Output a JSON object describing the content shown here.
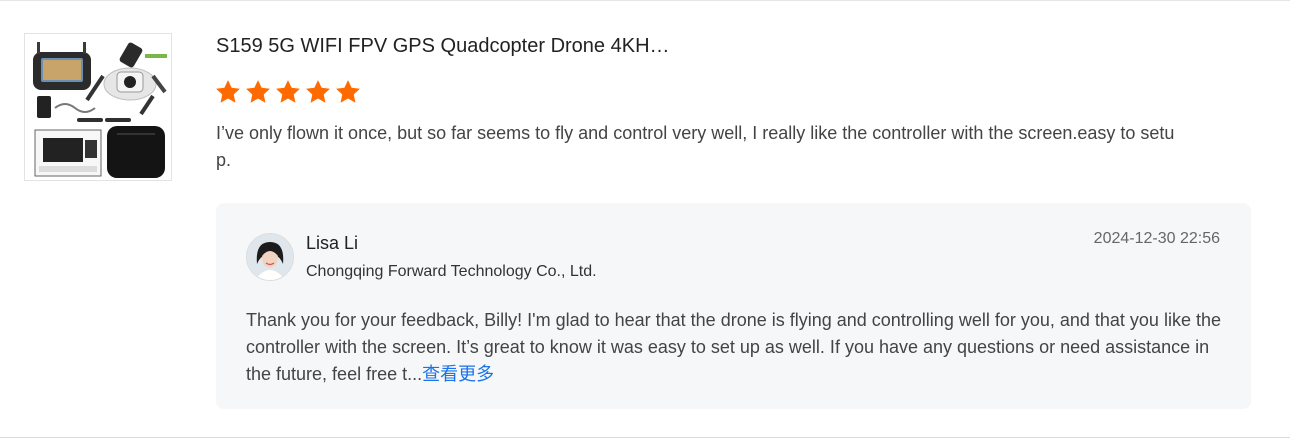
{
  "product": {
    "title": "S159 5G WIFI FPV GPS Quadcopter Drone 4KH…",
    "rating": 5,
    "rating_max": 5,
    "star_color": "#ff6a00",
    "image_icon": "drone-product-thumbnail"
  },
  "review": {
    "text": "I’ve only flown it once, but so far seems to fly and control very well, I really like the controller with the screen.easy to setup."
  },
  "reply": {
    "name": "Lisa Li",
    "company": "Chongqing Forward Technology Co., Ltd.",
    "time": "2024-12-30 22:56",
    "text": "Thank you for your feedback, Billy! I'm glad to hear that the drone is flying and controlling well for you, and that you like the controller with the screen. It’s great to know it was easy to set up as well. If you have any questions or need assistance in the future, feel free t...",
    "see_more_label": "查看更多",
    "link_color": "#1a73e8"
  }
}
